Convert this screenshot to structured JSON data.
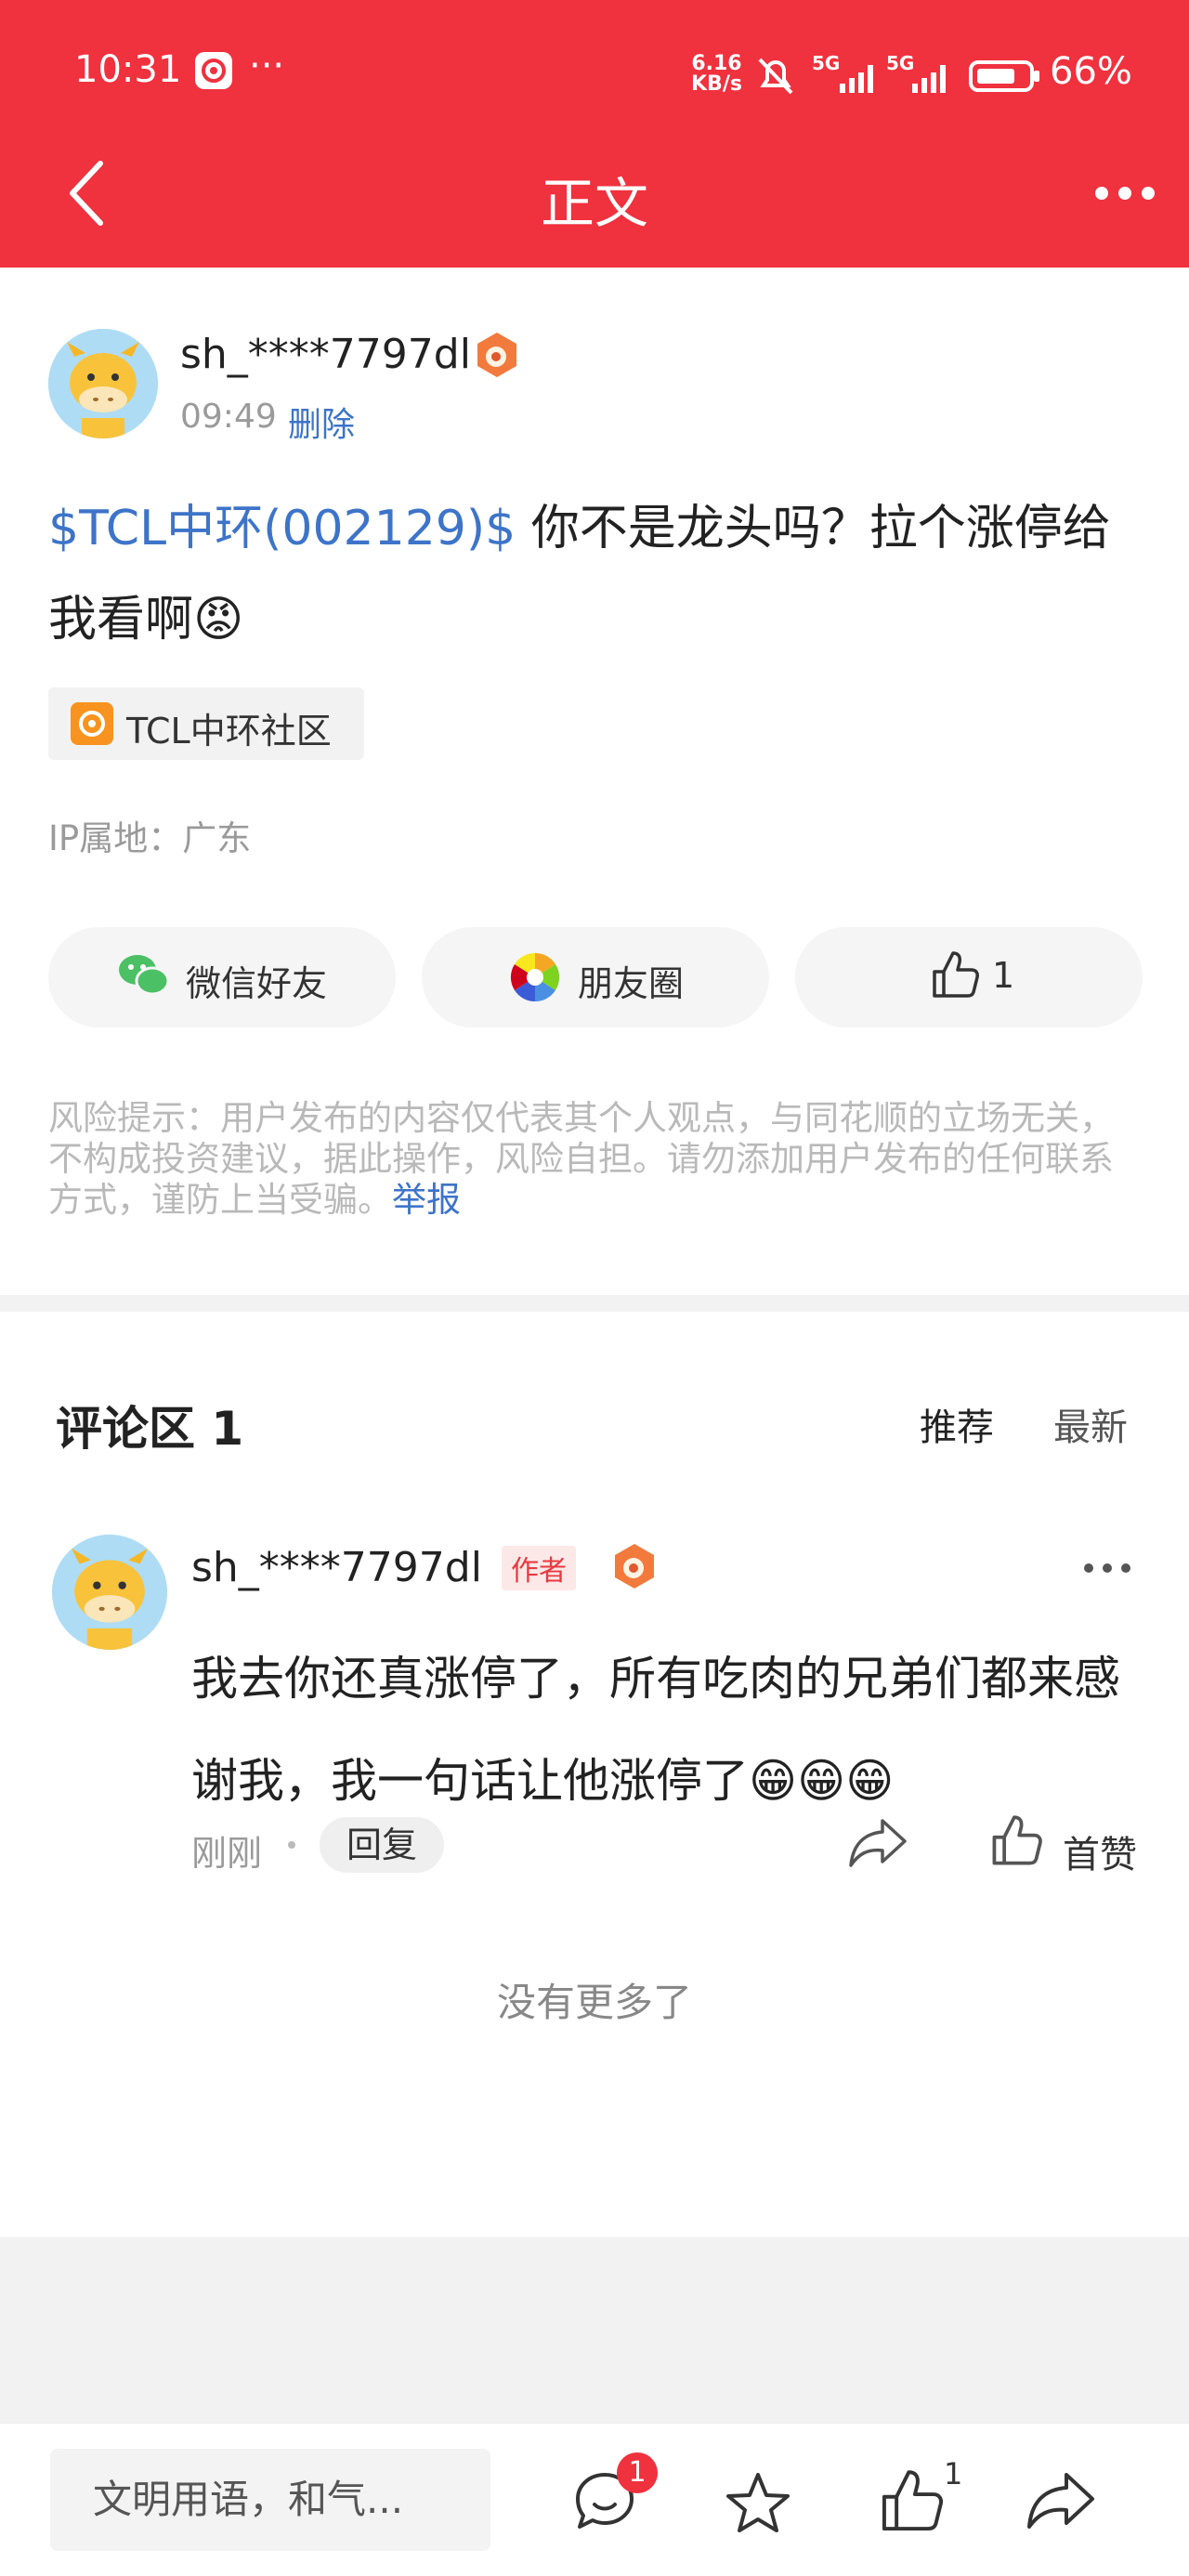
{
  "status_bar": {
    "time": "10:31",
    "ellipsis": "···",
    "net_speed_top": "6.16",
    "net_speed_bottom": "KB/s",
    "sig1": "5G",
    "sig2": "5G",
    "battery": "66%"
  },
  "nav": {
    "title": "正文"
  },
  "post": {
    "username": "sh_****7797dl",
    "time": "09:49",
    "delete_label": "删除",
    "stock_link": "$TCL中环(002129)$",
    "text": " 你不是龙头吗？拉个涨停给我看啊",
    "emoji": "😡",
    "community_tag": "TCL中环社区",
    "ip_location": "IP属地：广东"
  },
  "share": {
    "wechat_label": "微信好友",
    "moments_label": "朋友圈",
    "like_count": "1"
  },
  "risk": {
    "text": "风险提示：用户发布的内容仅代表其个人观点，与同花顺的立场无关，不构成投资建议，据此操作，风险自担。请勿添加用户发布的任何联系方式，谨防上当受骗。",
    "report_label": "举报"
  },
  "comments": {
    "title": "评论区 1",
    "sort_recommended": "推荐",
    "sort_latest": "最新",
    "items": [
      {
        "username": "sh_****7797dl",
        "author_badge": "作者",
        "text": "我去你还真涨停了，所有吃肉的兄弟们都来感谢我，我一句话让他涨停了😁😁😁",
        "time": "刚刚",
        "reply_label": "回复",
        "like_label": "首赞"
      }
    ],
    "no_more": "没有更多了"
  },
  "bottom_bar": {
    "input_placeholder": "文明用语，和气...",
    "comment_badge": "1",
    "like_count": "1"
  }
}
